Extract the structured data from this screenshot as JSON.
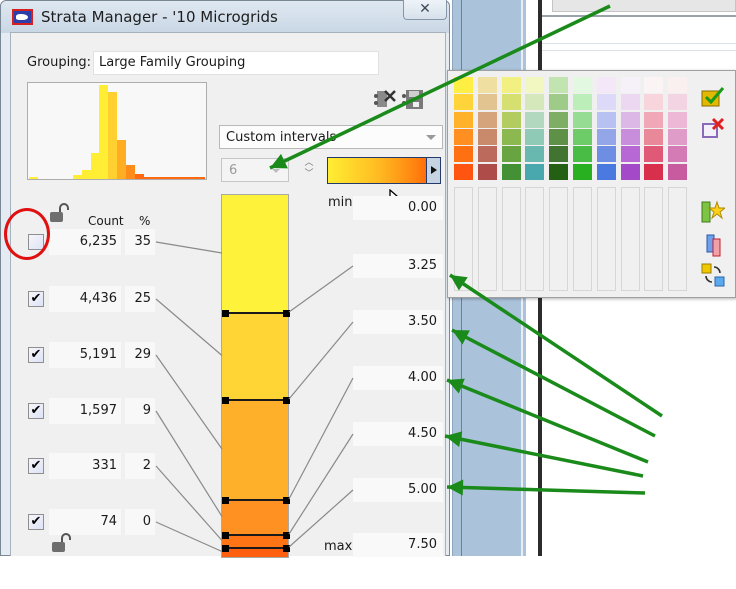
{
  "window": {
    "title": "Strata Manager - '10 Microgrids",
    "close_glyph": "✕",
    "app_icon": "us-map-icon"
  },
  "grouping": {
    "label": "Grouping:",
    "value": "Large Family Grouping"
  },
  "histogram": {
    "bins": [
      {
        "value": 0.02,
        "color": "#ffee33"
      },
      {
        "value": 0,
        "color": "#ffee33"
      },
      {
        "value": 0,
        "color": "#ffee33"
      },
      {
        "value": 0,
        "color": "#ffee33"
      },
      {
        "value": 0,
        "color": "#ffee33"
      },
      {
        "value": 0.04,
        "color": "#ffee33"
      },
      {
        "value": 0.1,
        "color": "#ffee33"
      },
      {
        "value": 0.28,
        "color": "#ffee33"
      },
      {
        "value": 1.0,
        "color": "#ffee33"
      },
      {
        "value": 0.93,
        "color": "#ffd030"
      },
      {
        "value": 0.42,
        "color": "#ffae22"
      },
      {
        "value": 0.15,
        "color": "#ff8c18"
      },
      {
        "value": 0.05,
        "color": "#ff6a10"
      },
      {
        "value": 0.02,
        "color": "#ff6a10"
      },
      {
        "value": 0.02,
        "color": "#ff6a10"
      },
      {
        "value": 0.02,
        "color": "#ff6a10"
      },
      {
        "value": 0.02,
        "color": "#ff6a10"
      },
      {
        "value": 0.02,
        "color": "#ff6a10"
      },
      {
        "value": 0.02,
        "color": "#ff6a10"
      },
      {
        "value": 0.02,
        "color": "#ff6a10"
      }
    ]
  },
  "toolbar": {
    "delete_icon": "delete-grouping-icon",
    "save_icon": "save-grouping-icon"
  },
  "classification": {
    "method": "Custom intervals",
    "num_classes": "6",
    "color_ramp_label": "yellow-to-orange"
  },
  "table": {
    "count_header": "Count",
    "pct_header": "%",
    "rows": [
      {
        "checked": false,
        "count": "6,235",
        "pct": "35"
      },
      {
        "checked": true,
        "count": "4,436",
        "pct": "25"
      },
      {
        "checked": true,
        "count": "5,191",
        "pct": "29"
      },
      {
        "checked": true,
        "count": "1,597",
        "pct": "9"
      },
      {
        "checked": true,
        "count": "331",
        "pct": "2"
      },
      {
        "checked": true,
        "count": "74",
        "pct": "0"
      }
    ]
  },
  "legend": {
    "min_label": "min",
    "max_label": "max",
    "breaks": [
      "0.00",
      "3.25",
      "3.50",
      "4.00",
      "4.50",
      "5.00",
      "7.50"
    ],
    "class_colors": [
      "#fff23a",
      "#ffd535",
      "#ffb02a",
      "#ff9022",
      "#ff7516",
      "#ff6010"
    ]
  },
  "palette": {
    "columns": [
      [
        "#ffee44",
        "#ffd43a",
        "#ffb22a",
        "#ff8f20",
        "#ff7010",
        "#ff5510"
      ],
      [
        "#efdfa0",
        "#e2c490",
        "#d6a47c",
        "#c98a6c",
        "#bb6a5c",
        "#ad4c48"
      ],
      [
        "#f2f080",
        "#d6e070",
        "#b2cc60",
        "#8cb850",
        "#68a440",
        "#449034"
      ],
      [
        "#f2f6c0",
        "#d4e8bc",
        "#b2d8c0",
        "#8ecab6",
        "#68b8b0",
        "#48a8ae"
      ],
      [
        "#c2e4b0",
        "#9ecc88",
        "#7eae64",
        "#5e9048",
        "#407430",
        "#246014"
      ],
      [
        "#e2f8e0",
        "#bceeba",
        "#96dc92",
        "#6ecc68",
        "#48bc44",
        "#28b020"
      ],
      [
        "#f4e8f8",
        "#dcdaf8",
        "#b8c2f2",
        "#92a6e8",
        "#6e8ee4",
        "#4a7ae0"
      ],
      [
        "#f6f0f8",
        "#ecd8f0",
        "#dcb8e6",
        "#c88edc",
        "#b868d4",
        "#a44ac8"
      ],
      [
        "#fbf4f4",
        "#f8d4dc",
        "#f0a8b8",
        "#e88898",
        "#e05a78",
        "#d8304c"
      ],
      [
        "#fbf0f0",
        "#f2d4e2",
        "#ecb8d6",
        "#e09cc8",
        "#d47ab4",
        "#c85aa0"
      ]
    ],
    "side_icons": [
      "apply-check-icon",
      "cancel-x-icon",
      "add-favorite-icon",
      "compare-icon",
      "swap-colors-icon"
    ]
  },
  "annotations": {
    "arrow_color": "#1a8a1a",
    "circle_color": "#e01010"
  }
}
